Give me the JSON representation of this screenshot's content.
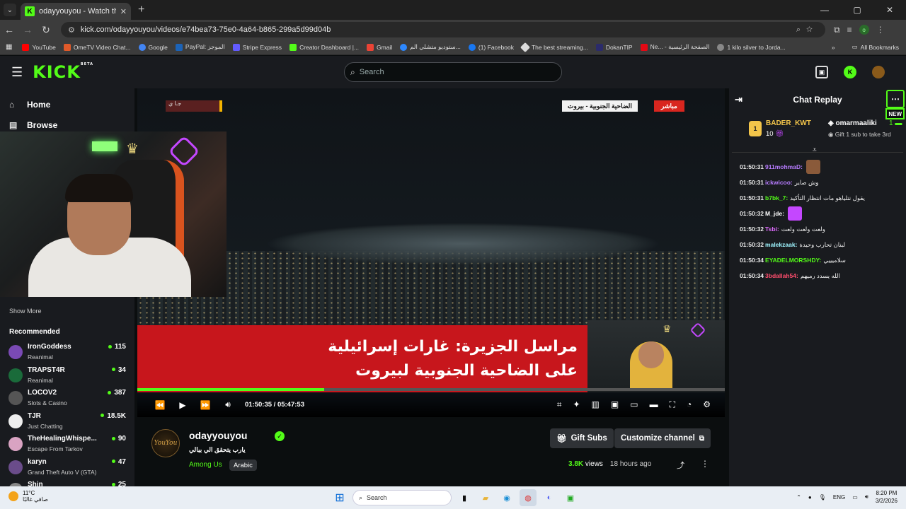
{
  "browser": {
    "tab_title": "odayyouyou - Watch the VOD o",
    "url": "kick.com/odayyouyou/videos/e74bea73-75e0-4a64-b865-299a5d99d04b",
    "bookmarks": [
      "YouTube",
      "OmeTV Video Chat...",
      "Google",
      "PayPal: الموجز",
      "Stripe Express",
      "Creator Dashboard |...",
      "Gmail",
      "ستوديو متشلي الم...",
      "(1) Facebook",
      "The best streaming...",
      "DokanTIP",
      "Ne... - الصفحة الرئيسية",
      "1 kilo silver to Jorda..."
    ],
    "all_bookmarks": "All Bookmarks",
    "profile_initial": "o"
  },
  "header": {
    "logo": "KICK",
    "logo_sup": "BETA",
    "search_placeholder": "Search"
  },
  "sidebar": {
    "nav": [
      {
        "label": "Home",
        "icon": "home-icon"
      },
      {
        "label": "Browse",
        "icon": "browse-icon"
      }
    ],
    "show_more": "Show More",
    "recommended_heading": "Recommended",
    "recommended": [
      {
        "name": "IronGoddess",
        "game": "Reanimal",
        "viewers": "115",
        "color": "#7a4ab5"
      },
      {
        "name": "TRAPST4R",
        "game": "Reanimal",
        "viewers": "34",
        "color": "#1a6b3a"
      },
      {
        "name": "LOCOV2",
        "game": "Slots & Casino",
        "viewers": "387",
        "color": "#555"
      },
      {
        "name": "TJR",
        "game": "Just Chatting",
        "viewers": "18.5K",
        "color": "#eee"
      },
      {
        "name": "TheHealingWhispe...",
        "game": "Escape From Tarkov",
        "viewers": "90",
        "color": "#d9a3c2"
      },
      {
        "name": "karyn",
        "game": "Grand Theft Auto V (GTA)",
        "viewers": "47",
        "color": "#6a4c8a"
      },
      {
        "name": "Shin",
        "game": "",
        "viewers": "25",
        "color": "#888"
      }
    ]
  },
  "video": {
    "live_tag": "مباشر",
    "location_tag": "الضاحية الجنوبية - بيروت",
    "channel_logo_text": "جـا ي",
    "headline_line1": "مراسل الجزيرة: غارات إسرائيلية",
    "headline_line2": "على الضاحية الجنوبية لبيروت",
    "current_time": "01:50:35",
    "duration": "05:47:53",
    "progress_fraction": 0.318
  },
  "chat": {
    "title": "Chat Replay",
    "new_label": "NEW",
    "top_gifter_rank": "1",
    "top_gifter": "BADER_KWT",
    "top_gifter_count": "10",
    "second_gifter": "omarmaaliki",
    "second_gifter_count": "1",
    "second_gifter_sub": "Gift 1 sub to take 3rd",
    "messages": [
      {
        "time": "01:50:31",
        "user": "911mohmaD:",
        "text": "",
        "color": "#b77cff",
        "emote": "#8a5a3a"
      },
      {
        "time": "01:50:31",
        "user": "ickwicoo:",
        "text": "وش صاير",
        "color": "#b77cff",
        "emote": ""
      },
      {
        "time": "01:50:31",
        "user": "b7bk_7:",
        "text": "يقول نتلياهو مات انتظار التأكيد",
        "color": "#53fc18",
        "emote": ""
      },
      {
        "time": "01:50:32",
        "user": "M_jde:",
        "text": "",
        "color": "#ffffff",
        "emote": "#c447ff"
      },
      {
        "time": "01:50:32",
        "user": "Tsbi:",
        "text": "ولعت ولعت ولعت",
        "color": "#e06cff",
        "emote": ""
      },
      {
        "time": "01:50:32",
        "user": "malekzaak:",
        "text": "لبنان تحارب وحيدة",
        "color": "#9ff5ff",
        "emote": ""
      },
      {
        "time": "01:50:34",
        "user": "EYADELMORSHDY:",
        "text": "سلاميييي",
        "color": "#53fc18",
        "emote": ""
      },
      {
        "time": "01:50:34",
        "user": "3bdallah54:",
        "text": "الله يسدد رميهم",
        "color": "#ff4d6d",
        "emote": ""
      }
    ]
  },
  "channel": {
    "avatar_text": "YouYou",
    "name": "odayyouyou",
    "video_title": "يارب يتحقق الي ببالي",
    "category": "Among Us",
    "language": "Arabic",
    "gift_subs": "Gift Subs",
    "customize": "Customize channel",
    "views_count": "3.8K",
    "views_label": "views",
    "time_ago": "18 hours ago"
  },
  "taskbar": {
    "temp": "11°C",
    "weather_text": "صافي غالبًا",
    "search": "Search",
    "lang": "ENG",
    "time": "8:20 PM",
    "date": "3/2/2026"
  },
  "colors": {
    "accent": "#53fc18",
    "bg": "#0b0e0f",
    "panel": "#191b1f"
  }
}
